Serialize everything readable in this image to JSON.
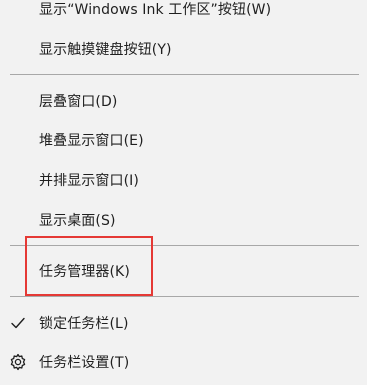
{
  "menu": {
    "items": [
      {
        "label": "显示“Windows Ink 工作区”按钮(W)"
      },
      {
        "label": "显示触摸键盘按钮(Y)"
      },
      {
        "label": "层叠窗口(D)"
      },
      {
        "label": "堆叠显示窗口(E)"
      },
      {
        "label": "并排显示窗口(I)"
      },
      {
        "label": "显示桌面(S)"
      },
      {
        "label": "任务管理器(K)"
      },
      {
        "label": "锁定任务栏(L)",
        "icon": "checkmark-icon"
      },
      {
        "label": "任务栏设置(T)",
        "icon": "gear-icon"
      }
    ]
  },
  "colors": {
    "menu_background": "#f2f2f2",
    "separator": "#a8a8a8",
    "highlight_border": "#e53935",
    "text": "#1f1f1f"
  }
}
